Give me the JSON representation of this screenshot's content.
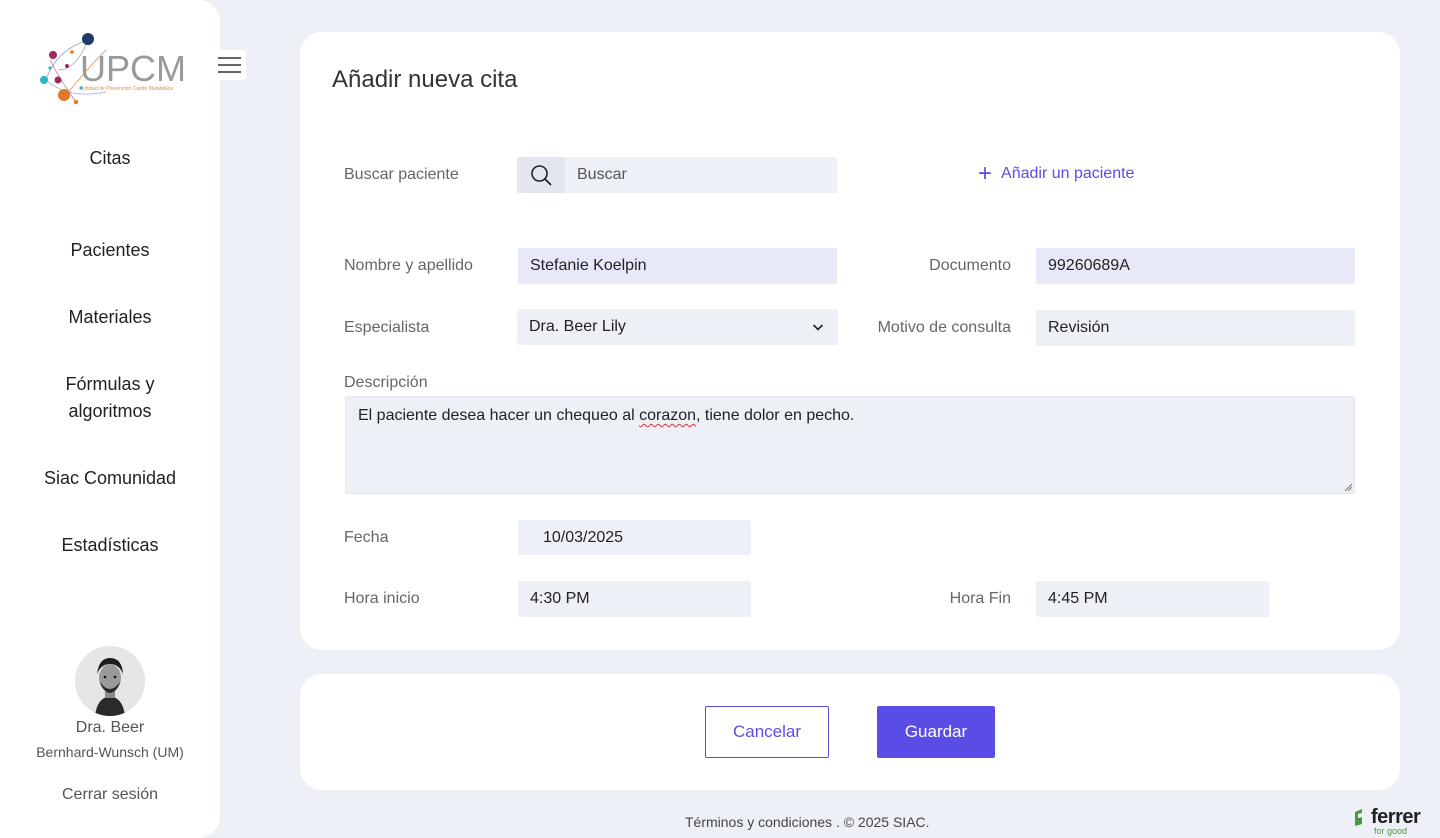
{
  "sidebar": {
    "logo_text": "UPCM",
    "logo_subtitle": "Unidad de Prevención Cardio Metabólica",
    "nav": {
      "citas": "Citas",
      "pacientes": "Pacientes",
      "materiales": "Materiales",
      "formulas_line1": "Fórmulas y",
      "formulas_line2": "algoritmos",
      "comunidad": "Siac Comunidad",
      "estadisticas": "Estadísticas"
    },
    "user": {
      "name": "Dra. Beer",
      "org": "Bernhard-Wunsch (UM)"
    },
    "logout": "Cerrar sesión"
  },
  "form": {
    "title": "Añadir nueva cita",
    "search": {
      "label": "Buscar paciente",
      "placeholder": "Buscar"
    },
    "add_patient": "Añadir un paciente",
    "name": {
      "label": "Nombre y apellido",
      "value": "Stefanie Koelpin"
    },
    "document": {
      "label": "Documento",
      "value": "99260689A"
    },
    "specialist": {
      "label": "Especialista",
      "value": "Dra. Beer Lily"
    },
    "reason": {
      "label": "Motivo de consulta",
      "value": "Revisión"
    },
    "description": {
      "label": "Descripción",
      "text_before": "El paciente desea hacer un chequeo al ",
      "misspelled": "corazon",
      "text_after": ", tiene dolor en pecho."
    },
    "date": {
      "label": "Fecha",
      "value": "10/03/2025"
    },
    "start_time": {
      "label": "Hora inicio",
      "value": "4:30 PM"
    },
    "end_time": {
      "label": "Hora Fin",
      "value": "4:45 PM"
    }
  },
  "actions": {
    "cancel": "Cancelar",
    "save": "Guardar"
  },
  "footer": {
    "text": "Términos y condiciones . © 2025 SIAC."
  },
  "brand": {
    "name": "ferrer",
    "tagline": "for good"
  },
  "colors": {
    "accent": "#5a4de6",
    "page_bg": "#eef0f8",
    "field_bg": "#eef0f8",
    "filled_field_bg": "#e8e9f8",
    "brand_green": "#4a9a3a"
  }
}
